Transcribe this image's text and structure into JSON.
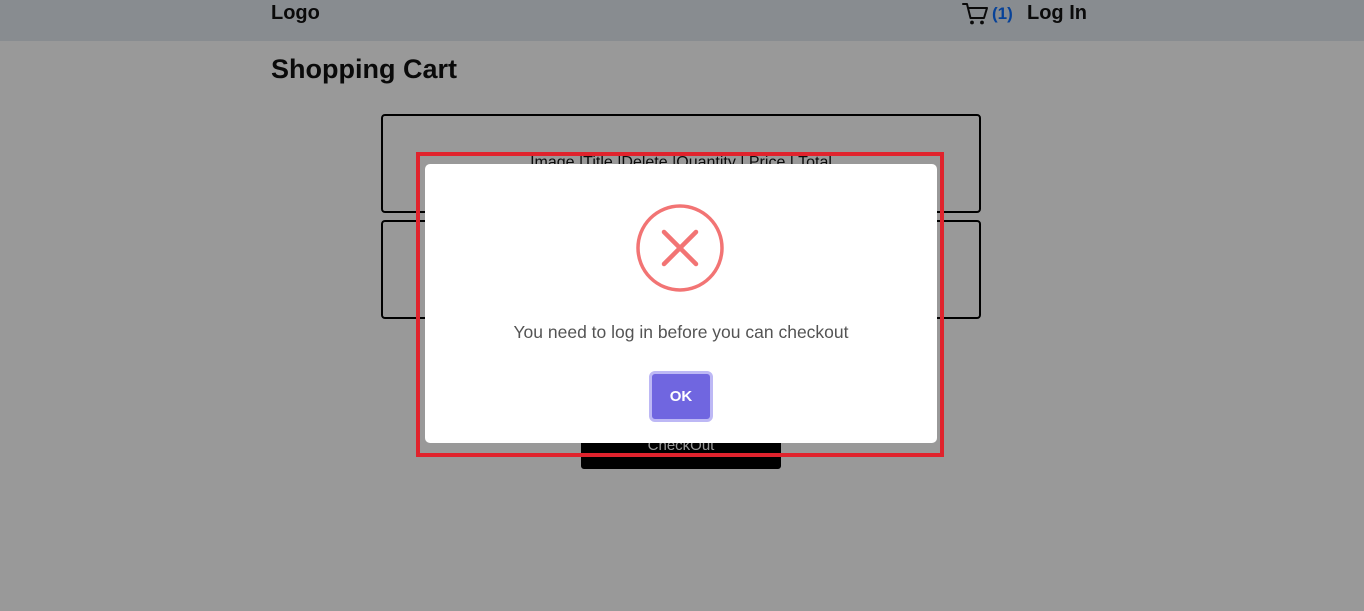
{
  "navbar": {
    "logo": "Logo",
    "cart_icon": "shopping-cart-icon",
    "cart_count": "(1)",
    "login_label": "Log In"
  },
  "page": {
    "title": "Shopping Cart",
    "cart_table_header": "Image |Title |Delete |Quantity | Price | Total",
    "checkout_label": "CheckOut"
  },
  "modal": {
    "icon": "error-x-icon",
    "message": "You need to log in before you can checkout",
    "ok_label": "OK"
  },
  "colors": {
    "error_icon": "#f27474",
    "ok_button": "#7066e0",
    "cart_count": "#0d6efd",
    "highlight_frame": "#e0232d"
  }
}
